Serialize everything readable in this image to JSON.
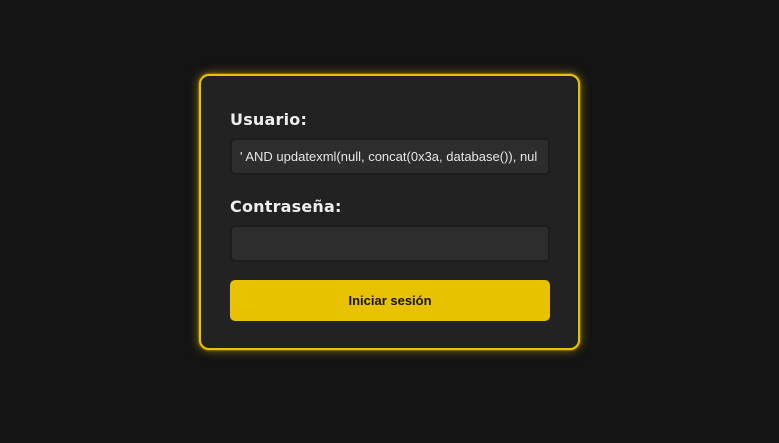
{
  "login": {
    "username_label": "Usuario:",
    "username_value": "' AND updatexml(null, concat(0x3a, database()), nul",
    "password_label": "Contraseña:",
    "password_value": "",
    "submit_label": "Iniciar sesión"
  },
  "colors": {
    "background": "#141414",
    "card": "#222222",
    "accent": "#e8c200",
    "text": "#eeeeee"
  }
}
